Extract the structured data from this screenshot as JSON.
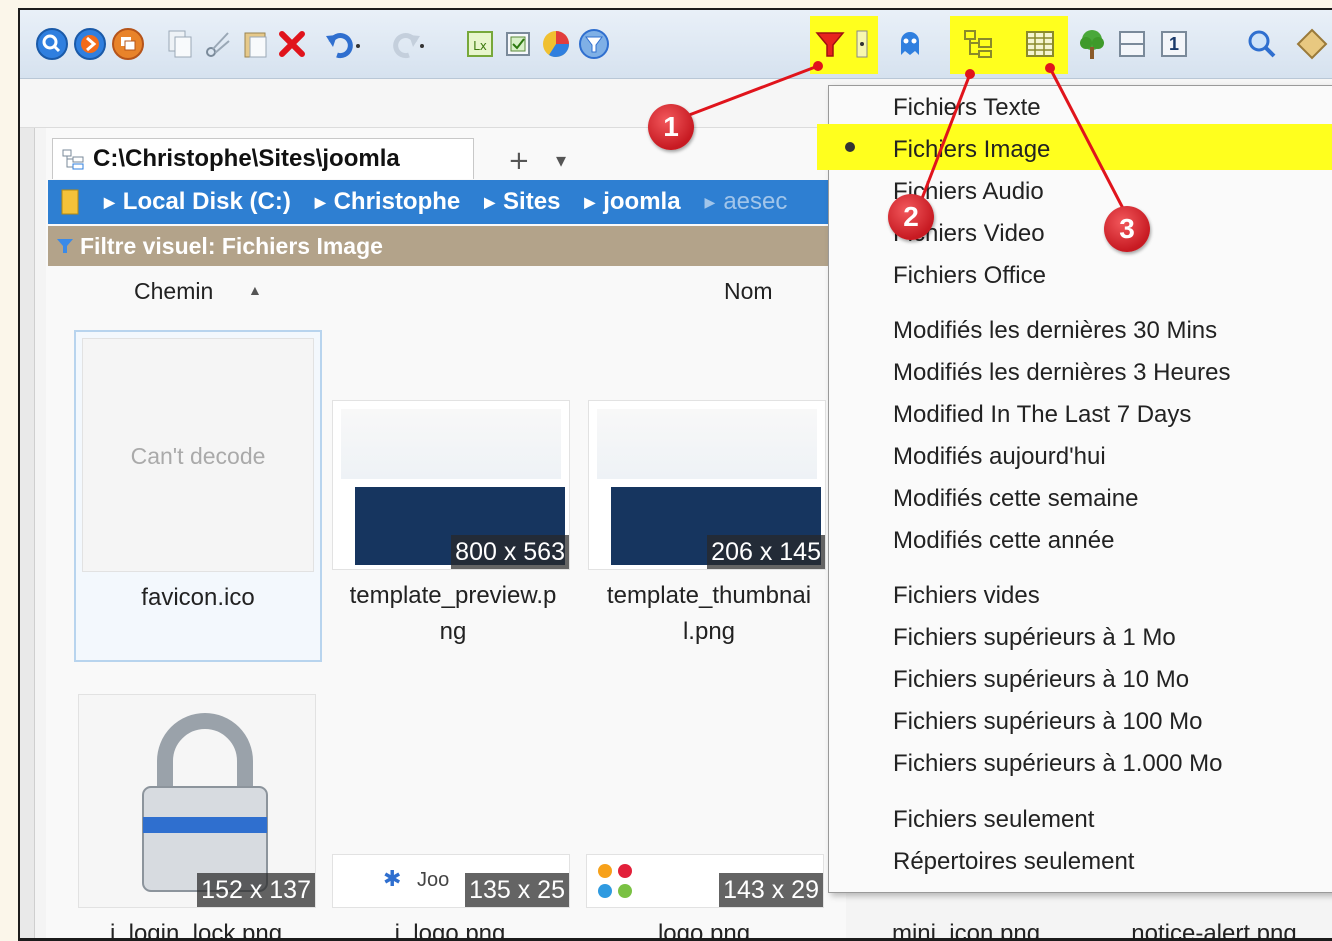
{
  "tab": {
    "path": "C:\\Christophe\\Sites\\joomla",
    "plus": "+",
    "dropdown": "▾"
  },
  "breadcrumb": [
    "Local Disk (C:)",
    "Christophe",
    "Sites",
    "joomla",
    "aesec"
  ],
  "filter_bar": {
    "text": "Filtre visuel:  Fichiers Image"
  },
  "columns": {
    "path": "Chemin",
    "sort_indicator": "▲",
    "name": "Nom"
  },
  "files": [
    {
      "name_l1": "favicon.ico",
      "name_l2": "",
      "placeholder": "Can't decode",
      "dims": ""
    },
    {
      "name_l1": "template_preview.p",
      "name_l2": "ng",
      "placeholder": "",
      "dims": "800 x 563"
    },
    {
      "name_l1": "template_thumbnai",
      "name_l2": "l.png",
      "placeholder": "",
      "dims": "206 x 145"
    },
    {
      "name_l1": "i_login_lock.png",
      "name_l2": "",
      "placeholder": "",
      "dims": "152 x 137"
    },
    {
      "name_l1": "i_logo.png",
      "name_l2": "",
      "placeholder": "",
      "dims": "135 x 25"
    },
    {
      "name_l1": "logo.png",
      "name_l2": "",
      "placeholder": "",
      "dims": "143 x 29"
    },
    {
      "name_l1": "mini_icon.png",
      "name_l2": "",
      "placeholder": "",
      "dims": ""
    },
    {
      "name_l1": "notice-alert.png",
      "name_l2": "",
      "placeholder": "",
      "dims": ""
    }
  ],
  "logo_text": "Joo",
  "menu": {
    "group1": [
      "Fichiers Texte",
      "Fichiers Image",
      "Fichiers Audio",
      "Fichiers Video",
      "Fichiers Office"
    ],
    "group2": [
      "Modifiés les dernières 30 Mins",
      "Modifiés les dernières 3 Heures",
      "Modified In The Last 7 Days",
      "Modifiés aujourd'hui",
      "Modifiés cette semaine",
      "Modifiés cette année"
    ],
    "group3": [
      "Fichiers vides",
      "Fichiers supérieurs à 1 Mo",
      "Fichiers supérieurs à 10 Mo",
      "Fichiers supérieurs à 100 Mo",
      "Fichiers supérieurs à 1.000 Mo"
    ],
    "group4": [
      "Fichiers seulement",
      "Répertoires seulement"
    ],
    "selected": "Fichiers Image"
  },
  "markers": [
    "1",
    "2",
    "3"
  ],
  "toolbar_icons": [
    "back-icon",
    "forward-icon",
    "window-icon",
    "copy-icon",
    "cut-icon",
    "paste-icon",
    "delete-icon",
    "undo-icon",
    "redo-icon",
    "label-icon",
    "checkbox-icon",
    "pie-icon",
    "filter-circle-icon",
    "filter-icon",
    "dropdown-arrow-icon",
    "ghost-icon",
    "tree-view-icon",
    "grid-view-icon",
    "tree-icon",
    "panes-icon",
    "number-one-icon",
    "search-icon",
    "tag-icon"
  ],
  "toolbar_number": "1",
  "colors": {
    "highlight": "#ffff1e",
    "breadcrumb": "#2e7fd2",
    "filter_bar": "#b3a38a",
    "marker": "#d2232a"
  }
}
